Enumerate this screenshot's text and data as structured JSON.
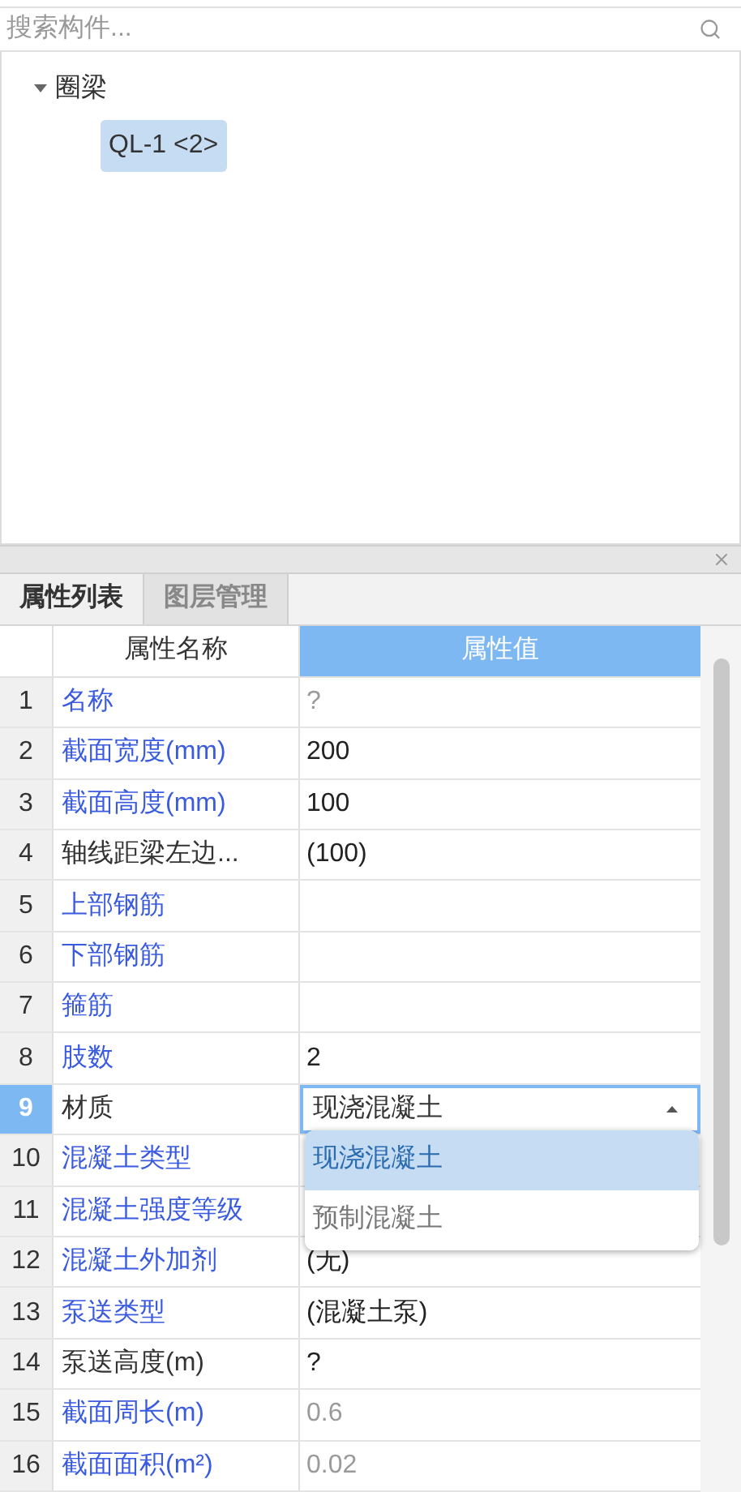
{
  "search": {
    "placeholder": "搜索构件..."
  },
  "tree": [
    {
      "label": "圈梁",
      "expanded": true,
      "selected": false,
      "children": [
        {
          "label": "QL-1 <2>",
          "selected": true
        }
      ]
    }
  ],
  "tabs": [
    {
      "label": "属性列表",
      "selected": true
    },
    {
      "label": "图层管理",
      "selected": false
    }
  ],
  "table": {
    "columns": [
      "属性名称",
      "属性值"
    ],
    "rows": [
      {
        "index": "1",
        "name": "名称",
        "value": "?",
        "linked": true,
        "dimmed": true,
        "selected": false
      },
      {
        "index": "2",
        "name": "截面宽度(mm)",
        "value": "200",
        "linked": true,
        "dimmed": false,
        "selected": false
      },
      {
        "index": "3",
        "name": "截面高度(mm)",
        "value": "100",
        "linked": true,
        "dimmed": false,
        "selected": false
      },
      {
        "index": "4",
        "name": "轴线距梁左边...",
        "value": "(100)",
        "linked": false,
        "dimmed": false,
        "selected": false
      },
      {
        "index": "5",
        "name": "上部钢筋",
        "linked": true,
        "selected": false
      },
      {
        "index": "6",
        "name": "下部钢筋",
        "linked": true,
        "selected": false
      },
      {
        "index": "7",
        "name": "箍筋",
        "linked": true,
        "selected": false
      },
      {
        "index": "8",
        "name": "肢数",
        "value": "2",
        "linked": true,
        "dimmed": false,
        "selected": false
      },
      {
        "index": "9",
        "name": "材质",
        "value": "现浇混凝土",
        "linked": false,
        "selected": true,
        "kind": "dropdown"
      },
      {
        "index": "10",
        "name": "混凝土类型",
        "linked": true,
        "selected": false
      },
      {
        "index": "11",
        "name": "混凝土强度等级",
        "linked": true,
        "selected": false
      },
      {
        "index": "12",
        "name": "混凝土外加剂",
        "value": "(无)",
        "linked": true,
        "dimmed": false,
        "selected": false
      },
      {
        "index": "13",
        "name": "泵送类型",
        "value": "(混凝土泵)",
        "linked": true,
        "dimmed": false,
        "selected": false
      },
      {
        "index": "14",
        "name": "泵送高度(m)",
        "value": "?",
        "linked": false,
        "dimmed": false,
        "selected": false
      },
      {
        "index": "15",
        "name": "截面周长(m)",
        "value": "0.6",
        "linked": true,
        "dimmed": true,
        "selected": false
      },
      {
        "index": "16",
        "name": "截面面积(m²)",
        "value": "0.02",
        "linked": true,
        "dimmed": true,
        "selected": false
      }
    ]
  },
  "dropdown_options": [
    {
      "label": "现浇混凝土",
      "selected": true
    },
    {
      "label": "预制混凝土",
      "selected": false
    }
  ]
}
